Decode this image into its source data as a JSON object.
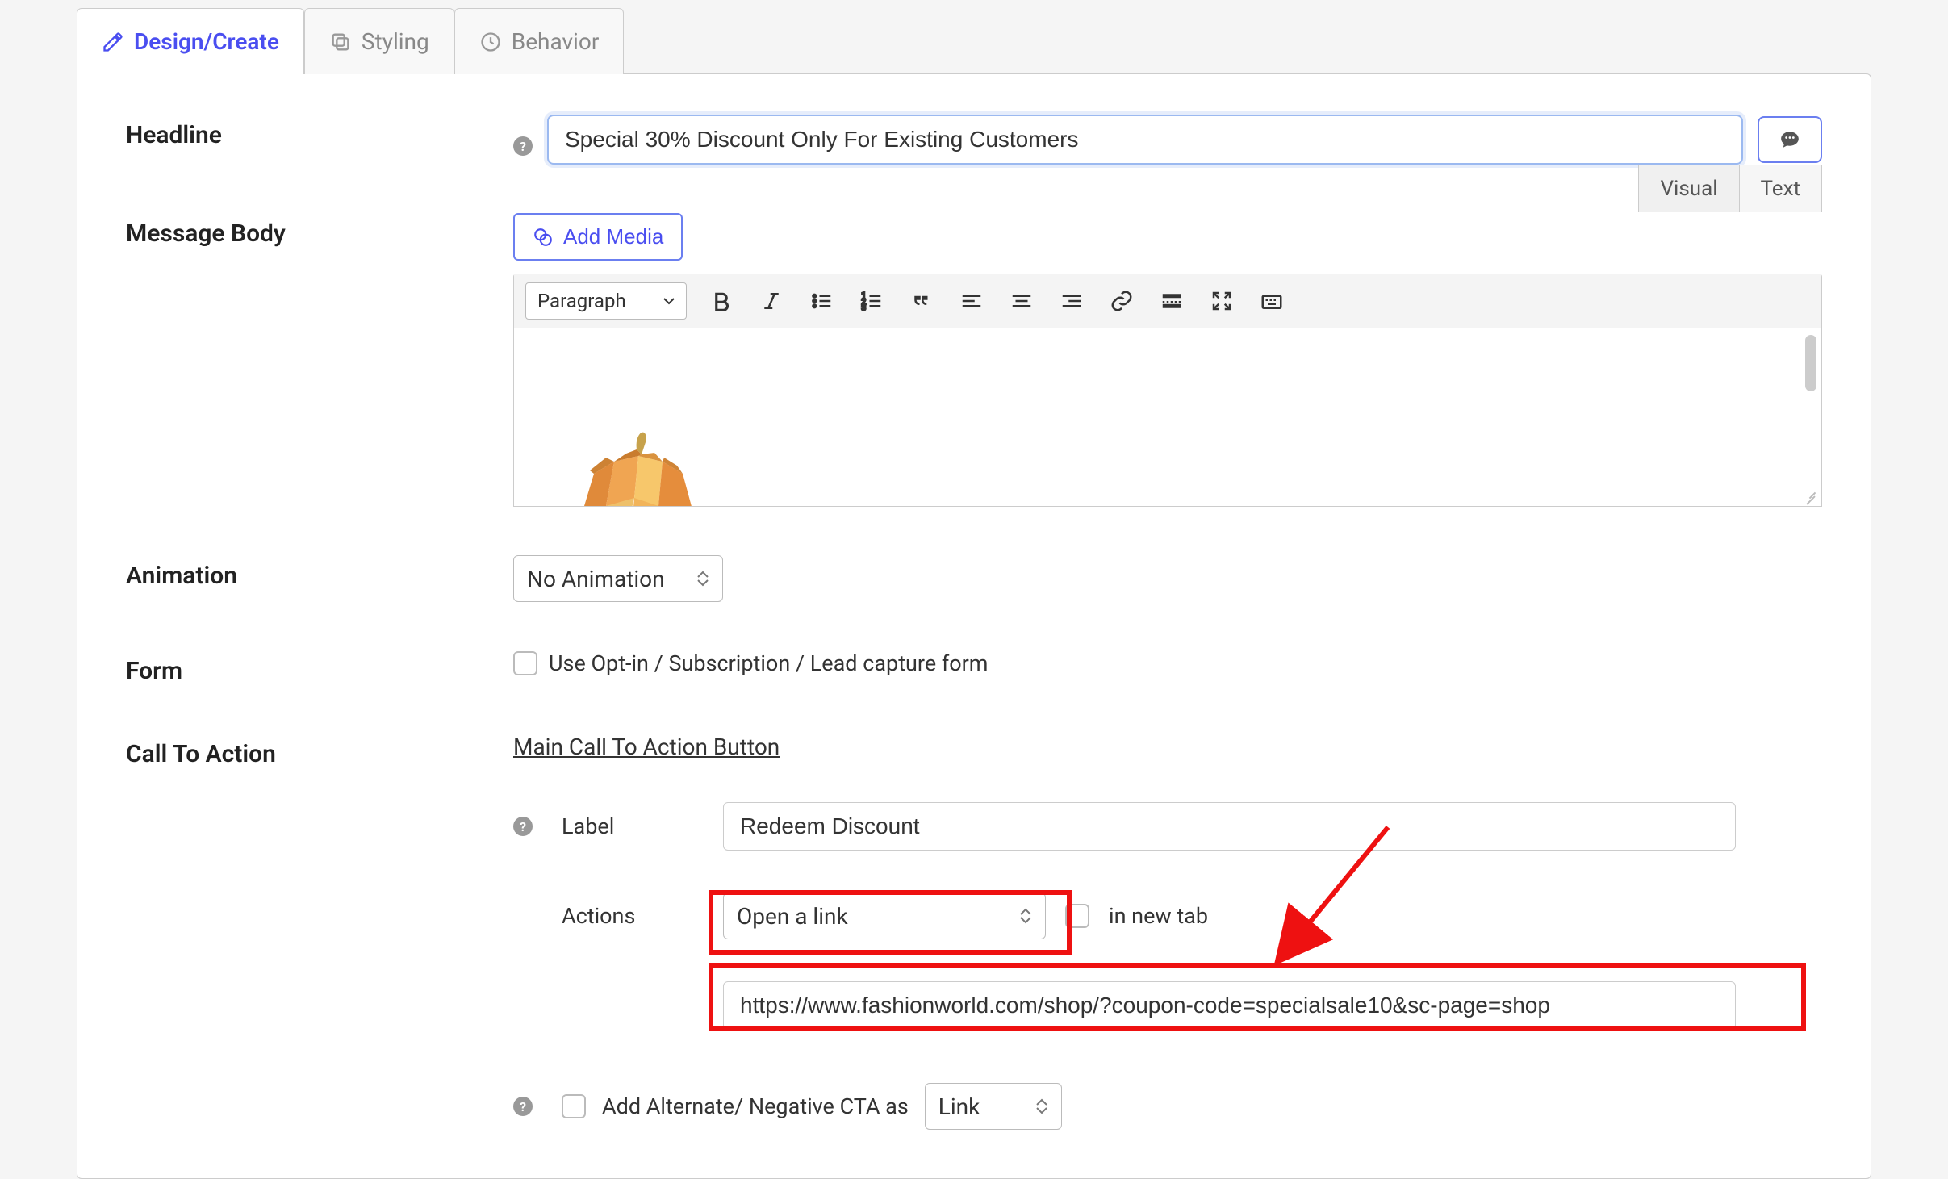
{
  "tabs": {
    "design": "Design/Create",
    "styling": "Styling",
    "behavior": "Behavior"
  },
  "editor_tabs": {
    "visual": "Visual",
    "text": "Text"
  },
  "labels": {
    "headline": "Headline",
    "message_body": "Message Body",
    "animation": "Animation",
    "form": "Form",
    "cta": "Call To Action",
    "label": "Label",
    "actions": "Actions",
    "add_media": "Add Media",
    "paragraph": "Paragraph",
    "in_new_tab": "in new tab",
    "main_cta_button": "Main Call To Action Button",
    "add_alternate": "Add Alternate/ Negative CTA as",
    "use_optin": "Use Opt-in / Subscription / Lead capture form"
  },
  "fields": {
    "headline_value": "Special 30% Discount Only For Existing Customers",
    "animation_value": "No Animation",
    "cta_label_value": "Redeem Discount",
    "cta_action_value": "Open a link",
    "cta_url_value": "https://www.fashionworld.com/shop/?coupon-code=specialsale10&sc-page=shop",
    "alternate_type_value": "Link"
  }
}
